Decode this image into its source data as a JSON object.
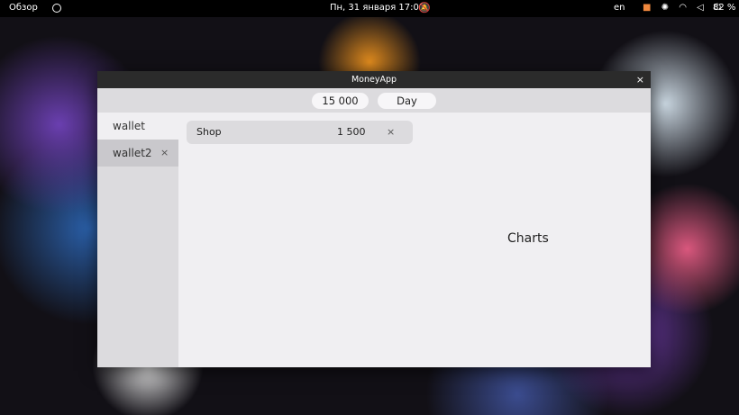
{
  "topbar": {
    "overview": "Обзор",
    "clock": "Пн, 31 января  17:05",
    "lang": "en",
    "battery": "82 %"
  },
  "window": {
    "title": "MoneyApp",
    "close": "×"
  },
  "toolbar": {
    "amount": "15 000",
    "period": "Day"
  },
  "sidebar": {
    "items": [
      {
        "label": "wallet"
      },
      {
        "label": "wallet2",
        "remove": "×"
      }
    ]
  },
  "entries": [
    {
      "name": "Shop",
      "amount": "1 500",
      "remove": "×"
    }
  ],
  "charts_label": "Charts"
}
